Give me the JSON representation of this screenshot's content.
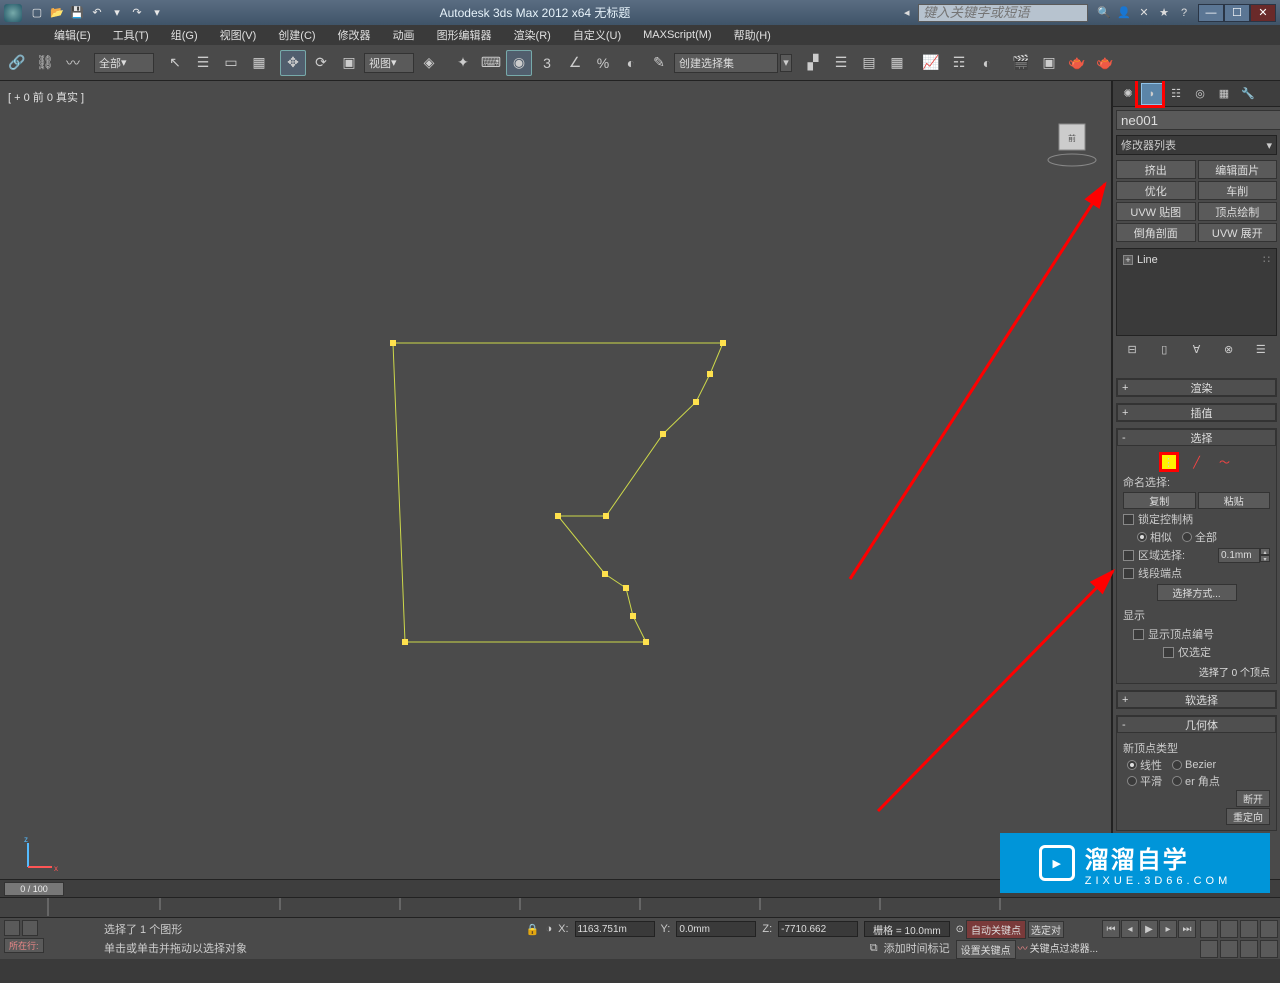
{
  "titlebar": {
    "title": "Autodesk 3ds Max 2012 x64   无标题",
    "search_placeholder": "键入关键字或短语"
  },
  "menubar": {
    "items": [
      "编辑(E)",
      "工具(T)",
      "组(G)",
      "视图(V)",
      "创建(C)",
      "修改器",
      "动画",
      "图形编辑器",
      "渲染(R)",
      "自定义(U)",
      "MAXScript(M)",
      "帮助(H)"
    ]
  },
  "toolbar": {
    "sel_filter": "全部",
    "view_combo": "视图",
    "named_set": "创建选择集"
  },
  "viewport": {
    "label": "[ + 0 前 0 真实 ]"
  },
  "command_panel": {
    "object_name": "ne001",
    "modifier_list_label": "修改器列表",
    "mod_buttons": [
      "挤出",
      "编辑面片",
      "优化",
      "车削",
      "UVW 贴图",
      "顶点绘制",
      "倒角剖面",
      "UVW 展开"
    ],
    "stack_item": "Line",
    "rollouts": {
      "render": "渲染",
      "interp": "插值",
      "selection": {
        "title": "选择",
        "named_sel_label": "命名选择:",
        "copy": "复制",
        "paste": "粘贴",
        "lock_handles": "锁定控制柄",
        "similar": "相似",
        "all": "全部",
        "area_select": "区域选择:",
        "area_value": "0.1mm",
        "segment_end": "线段端点",
        "select_by": "选择方式...",
        "display_label": "显示",
        "show_vert_num": "显示顶点编号",
        "only_selected": "仅选定",
        "status": "选择了 0 个顶点"
      },
      "soft_sel": "软选择",
      "geometry": {
        "title": "几何体",
        "new_vertex_type": "新顶点类型",
        "linear": "线性",
        "bezier": "Bezier",
        "smooth": "平滑",
        "bezier_corner": "er 角点",
        "break": "断开",
        "reverse": "重定向"
      }
    }
  },
  "timeline": {
    "frame_label": "0 / 100"
  },
  "statusbar": {
    "selection_status": "选择了 1 个图形",
    "prompt": "单击或单击并拖动以选择对象",
    "row_label": "所在行:",
    "coord_x_label": "X:",
    "coord_x": "1163.751m",
    "coord_y_label": "Y:",
    "coord_y": "0.0mm",
    "coord_z_label": "Z:",
    "coord_z": "-7710.662",
    "grid": "栅格 = 10.0mm",
    "add_time_tag": "添加时间标记",
    "auto_key": "自动关键点",
    "set_key": "设置关键点",
    "sel_set_label": "选定对",
    "key_filter": "关键点过滤器..."
  },
  "watermark": {
    "main": "溜溜自学",
    "sub": "ZIXUE.3D66.COM"
  }
}
